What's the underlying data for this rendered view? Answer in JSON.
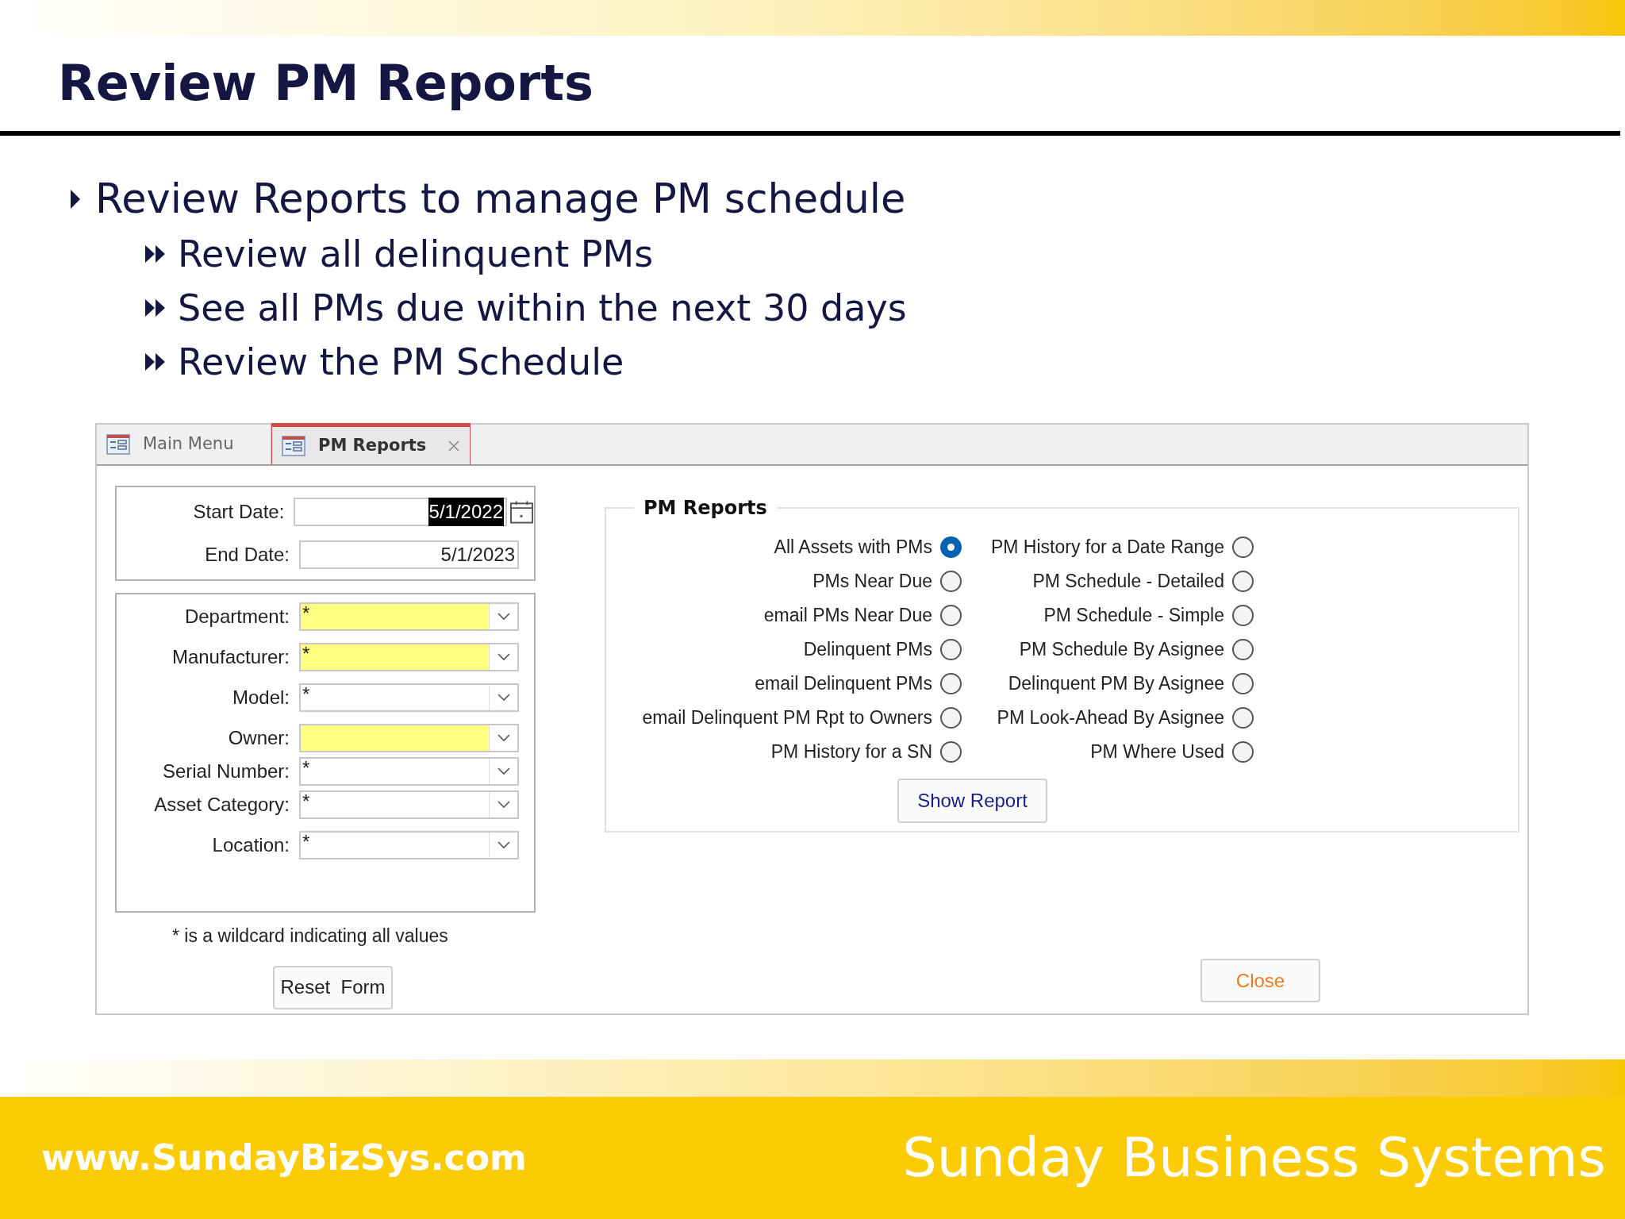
{
  "slide": {
    "title": "Review PM Reports",
    "bullets": [
      {
        "text": "Review Reports to manage PM schedule",
        "children": [
          {
            "text": "Review all delinquent PMs"
          },
          {
            "text": "See all PMs due within the next 30 days"
          },
          {
            "text": "Review the PM Schedule"
          }
        ]
      }
    ]
  },
  "app": {
    "tabs": [
      {
        "label": "Main Menu",
        "selected": false,
        "closable": false
      },
      {
        "label": "PM Reports",
        "selected": true,
        "closable": true
      }
    ],
    "dates": [
      {
        "label": "Start Date:",
        "value": "5/1/2022",
        "selected": true
      },
      {
        "label": "End Date:",
        "value": "5/1/2023",
        "selected": false
      }
    ],
    "filters": [
      {
        "label": "Department:",
        "value": "*",
        "required": true
      },
      {
        "label": "Manufacturer:",
        "value": "*",
        "required": true
      },
      {
        "label": "Model:",
        "value": "*",
        "required": false
      },
      {
        "label": "Owner:",
        "required": true
      },
      {
        "label": "Serial Number:",
        "value": "*",
        "required": false
      },
      {
        "label": "Asset Category:",
        "value": "*",
        "required": false
      },
      {
        "label": "Location:",
        "value": "*",
        "required": false
      }
    ],
    "note": "* is a wildcard indicating all values",
    "reset_button": "Reset  Form",
    "report_group": {
      "title": "PM Reports",
      "left_options": [
        {
          "label": "All Assets with PMs",
          "selected": true
        },
        {
          "label": "PMs Near Due",
          "selected": false
        },
        {
          "label": "email PMs Near Due",
          "selected": false
        },
        {
          "label": "Delinquent PMs",
          "selected": false
        },
        {
          "label": "email Delinquent PMs",
          "selected": false
        },
        {
          "label": "email Delinquent PM Rpt to Owners",
          "selected": false
        },
        {
          "label": "PM History for a SN",
          "selected": false
        }
      ],
      "right_options": [
        {
          "label": "PM History for a Date Range",
          "selected": false
        },
        {
          "label": "PM Schedule - Detailed",
          "selected": false
        },
        {
          "label": "PM Schedule - Simple",
          "selected": false
        },
        {
          "label": "PM Schedule By Asignee",
          "selected": false
        },
        {
          "label": "Delinquent PM By Asignee",
          "selected": false
        },
        {
          "label": "PM Look-Ahead By Asignee",
          "selected": false
        },
        {
          "label": "PM Where Used",
          "selected": false
        }
      ],
      "show_button": "Show Report"
    },
    "close_button": "Close"
  },
  "footer": {
    "url": "www.SundayBizSys.com",
    "company": "Sunday Business Systems"
  }
}
